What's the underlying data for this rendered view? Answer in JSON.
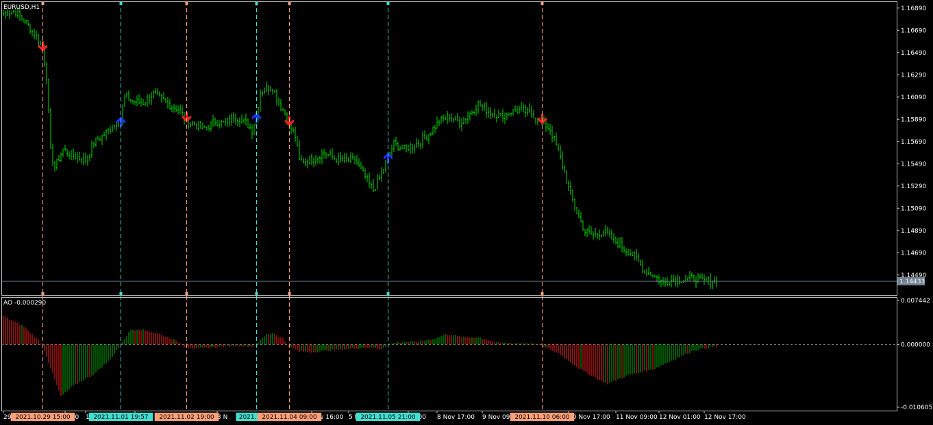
{
  "window": {
    "symbol_title": "EURUSD,H1",
    "ao_title": "AO -0.000290",
    "current_price_label": "1.14433"
  },
  "colors": {
    "background": "#000000",
    "frame": "#c8c8c8",
    "candle": "#00dc00",
    "ao_up": "#00b400",
    "ao_down": "#ff2020",
    "sell_arrow": "#ff2020",
    "buy_arrow": "#1e32ff",
    "sell_line": "#ffa07a",
    "buy_line": "#40e0d0",
    "price_line": "#708090"
  },
  "price_axis": {
    "labels": [
      "1.16890",
      "1.16690",
      "1.16490",
      "1.16290",
      "1.16090",
      "1.15890",
      "1.15690",
      "1.15490",
      "1.15290",
      "1.15090",
      "1.14890",
      "1.14690",
      "1.14490"
    ]
  },
  "ao_axis": {
    "labels": [
      "0.007442",
      "0.000000",
      "-0.010605"
    ]
  },
  "time_axis": {
    "labels": [
      {
        "text": "29 O",
        "bar": 0
      },
      {
        "text": "6:00",
        "bar": 30
      },
      {
        "text": "1",
        "bar": 40
      },
      {
        "text": "v 00",
        "bar": 64
      },
      {
        "text": "3 N",
        "bar": 104
      },
      {
        "text": "Nov 16:00",
        "bar": 150
      },
      {
        "text": "5 N",
        "bar": 168
      },
      {
        "text": "01:00",
        "bar": 197
      },
      {
        "text": "8 Nov 17:00",
        "bar": 211
      },
      {
        "text": "9 Nov 09:00",
        "bar": 233
      },
      {
        "text": "10 Nov 17:00",
        "bar": 275
      },
      {
        "text": "11 Nov 09:00",
        "bar": 298
      },
      {
        "text": "12 Nov 01:00",
        "bar": 319
      },
      {
        "text": "12 Nov 17:00",
        "bar": 341
      }
    ]
  },
  "signals": [
    {
      "type": "sell",
      "bar": 19,
      "time_label": "2021.10.29 15:00"
    },
    {
      "type": "buy",
      "bar": 57,
      "time_label": "2021.11.01 19:57"
    },
    {
      "type": "sell",
      "bar": 89,
      "time_label": "2021.11.02 19:00"
    },
    {
      "type": "buy",
      "bar": 123,
      "time_label": "2021.11.03"
    },
    {
      "type": "sell",
      "bar": 139,
      "time_label": "2021.11.04 09:00"
    },
    {
      "type": "buy",
      "bar": 187,
      "time_label": "2021.11.05 21:00"
    },
    {
      "type": "sell",
      "bar": 262,
      "time_label": "2021.11.10 06:00"
    }
  ],
  "chart_data": {
    "type": "bar",
    "price_range": [
      1.1431,
      1.1695
    ],
    "ao_range": [
      -0.010605,
      0.007442
    ],
    "bars": 348,
    "close_anchors": [
      [
        0,
        1.1684
      ],
      [
        5,
        1.1687
      ],
      [
        11,
        1.1676
      ],
      [
        16,
        1.1663
      ],
      [
        19,
        1.1653
      ],
      [
        21,
        1.1628
      ],
      [
        23,
        1.156
      ],
      [
        25,
        1.1546
      ],
      [
        29,
        1.1562
      ],
      [
        34,
        1.1556
      ],
      [
        40,
        1.1552
      ],
      [
        44,
        1.1568
      ],
      [
        50,
        1.1577
      ],
      [
        57,
        1.1589
      ],
      [
        59,
        1.161
      ],
      [
        63,
        1.1605
      ],
      [
        68,
        1.1604
      ],
      [
        73,
        1.1612
      ],
      [
        77,
        1.1606
      ],
      [
        82,
        1.1601
      ],
      [
        86,
        1.1597
      ],
      [
        89,
        1.1586
      ],
      [
        93,
        1.1585
      ],
      [
        97,
        1.158
      ],
      [
        103,
        1.1587
      ],
      [
        108,
        1.1585
      ],
      [
        112,
        1.1592
      ],
      [
        118,
        1.1586
      ],
      [
        121,
        1.1579
      ],
      [
        123,
        1.1592
      ],
      [
        125,
        1.1613
      ],
      [
        128,
        1.1617
      ],
      [
        131,
        1.1618
      ],
      [
        134,
        1.1604
      ],
      [
        137,
        1.1594
      ],
      [
        139,
        1.1584
      ],
      [
        142,
        1.1574
      ],
      [
        144,
        1.1551
      ],
      [
        150,
        1.1553
      ],
      [
        156,
        1.1559
      ],
      [
        161,
        1.1554
      ],
      [
        167,
        1.1551
      ],
      [
        171,
        1.1553
      ],
      [
        175,
        1.154
      ],
      [
        180,
        1.1525
      ],
      [
        184,
        1.154
      ],
      [
        187,
        1.1554
      ],
      [
        190,
        1.1567
      ],
      [
        195,
        1.1562
      ],
      [
        201,
        1.1567
      ],
      [
        206,
        1.1574
      ],
      [
        212,
        1.1587
      ],
      [
        217,
        1.1592
      ],
      [
        222,
        1.1586
      ],
      [
        227,
        1.1594
      ],
      [
        231,
        1.1603
      ],
      [
        237,
        1.1595
      ],
      [
        242,
        1.1592
      ],
      [
        247,
        1.1596
      ],
      [
        252,
        1.1597
      ],
      [
        257,
        1.1594
      ],
      [
        262,
        1.1587
      ],
      [
        266,
        1.158
      ],
      [
        270,
        1.1561
      ],
      [
        275,
        1.1527
      ],
      [
        279,
        1.1505
      ],
      [
        283,
        1.1488
      ],
      [
        287,
        1.1485
      ],
      [
        292,
        1.1488
      ],
      [
        297,
        1.148
      ],
      [
        302,
        1.1473
      ],
      [
        307,
        1.1466
      ],
      [
        311,
        1.1455
      ],
      [
        316,
        1.1449
      ],
      [
        321,
        1.1442
      ],
      [
        326,
        1.1445
      ],
      [
        331,
        1.1445
      ],
      [
        336,
        1.1446
      ],
      [
        341,
        1.1443
      ],
      [
        347,
        1.1443
      ]
    ],
    "ao_anchors": [
      [
        0,
        0.0048
      ],
      [
        10,
        0.003
      ],
      [
        19,
        0.0
      ],
      [
        24,
        -0.005
      ],
      [
        28,
        -0.0088
      ],
      [
        34,
        -0.007
      ],
      [
        44,
        -0.005
      ],
      [
        52,
        -0.0025
      ],
      [
        57,
        0.0
      ],
      [
        62,
        0.0025
      ],
      [
        66,
        0.0026
      ],
      [
        74,
        0.002
      ],
      [
        82,
        0.001
      ],
      [
        89,
        -0.0005
      ],
      [
        95,
        -0.0007
      ],
      [
        104,
        -0.0004
      ],
      [
        114,
        -0.0002
      ],
      [
        121,
        -0.0003
      ],
      [
        123,
        0.0
      ],
      [
        128,
        0.0017
      ],
      [
        131,
        0.002
      ],
      [
        136,
        0.001
      ],
      [
        139,
        -0.0004
      ],
      [
        144,
        -0.0012
      ],
      [
        150,
        -0.0013
      ],
      [
        158,
        -0.001
      ],
      [
        167,
        -0.0008
      ],
      [
        176,
        -0.0005
      ],
      [
        184,
        -0.0008
      ],
      [
        187,
        0.0
      ],
      [
        192,
        0.0004
      ],
      [
        202,
        0.0005
      ],
      [
        210,
        0.001
      ],
      [
        216,
        0.0018
      ],
      [
        224,
        0.0012
      ],
      [
        232,
        0.0012
      ],
      [
        240,
        0.0003
      ],
      [
        248,
        0.0002
      ],
      [
        256,
        0.0002
      ],
      [
        262,
        -0.0002
      ],
      [
        270,
        -0.0015
      ],
      [
        280,
        -0.004
      ],
      [
        290,
        -0.006
      ],
      [
        294,
        -0.0066
      ],
      [
        304,
        -0.0052
      ],
      [
        316,
        -0.0042
      ],
      [
        326,
        -0.0026
      ],
      [
        336,
        -0.001
      ],
      [
        347,
        -0.0003
      ]
    ]
  }
}
